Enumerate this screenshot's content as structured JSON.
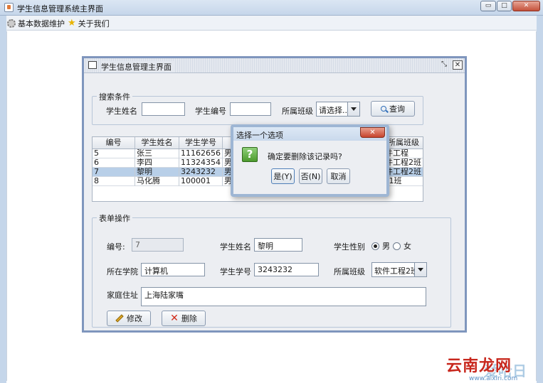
{
  "window": {
    "title": "学生信息管理系统主界面",
    "controls": {
      "minimize": "▭",
      "maximize": "□",
      "close": "✕"
    }
  },
  "menubar": {
    "items": [
      {
        "label": "基本数据维护",
        "icon": "gear-icon"
      },
      {
        "label": "关于我们",
        "icon": "star-icon"
      }
    ]
  },
  "internal_frame": {
    "title": "学生信息管理主界面",
    "search": {
      "legend": "搜索条件",
      "name_label": "学生姓名",
      "name_value": "",
      "id_label": "学生编号",
      "id_value": "",
      "class_label": "所属班级",
      "class_value": "请选择...",
      "search_button": "查询"
    },
    "table": {
      "columns": [
        "编号",
        "学生姓名",
        "学生学号",
        "",
        "所属班级"
      ],
      "rows": [
        {
          "id": "5",
          "name": "张三",
          "number": "11162656",
          "gender": "男",
          "class": "件工程"
        },
        {
          "id": "6",
          "name": "李四",
          "number": "11324354",
          "gender": "男",
          "class": "件工程2班"
        },
        {
          "id": "7",
          "name": "黎明",
          "number": "3243232",
          "gender": "男",
          "class": "件工程2班"
        },
        {
          "id": "8",
          "name": "马化腾",
          "number": "100001",
          "gender": "男",
          "class": "‡1班"
        }
      ],
      "selected_row": 2
    },
    "form": {
      "legend": "表单操作",
      "id_label": "编号:",
      "id_value": "7",
      "name_label": "学生姓名",
      "name_value": "黎明",
      "gender_label": "学生性别",
      "gender_male": "男",
      "gender_female": "女",
      "gender_selected": "male",
      "college_label": "所在学院",
      "college_value": "计算机",
      "number_label": "学生学号",
      "number_value": "3243232",
      "class_label": "所属班级",
      "class_value": "软件工程2班",
      "address_label": "家庭住址",
      "address_value": "上海陆家嘴",
      "edit_button": "修改",
      "delete_button": "删除"
    }
  },
  "dialog": {
    "title": "选择一个选项",
    "close": "✕",
    "icon_glyph": "?",
    "message": "确定要删除该记录吗?",
    "yes": "是(Y)",
    "no": "否(N)",
    "cancel": "取消"
  },
  "watermark": {
    "main": "云南龙网",
    "overlay": "爱哈日",
    "url": "www.aixiri.com"
  },
  "colors": {
    "selection": "#b8cfe8",
    "frame_border": "#7f96bd",
    "watermark_red": "#c8281e"
  }
}
